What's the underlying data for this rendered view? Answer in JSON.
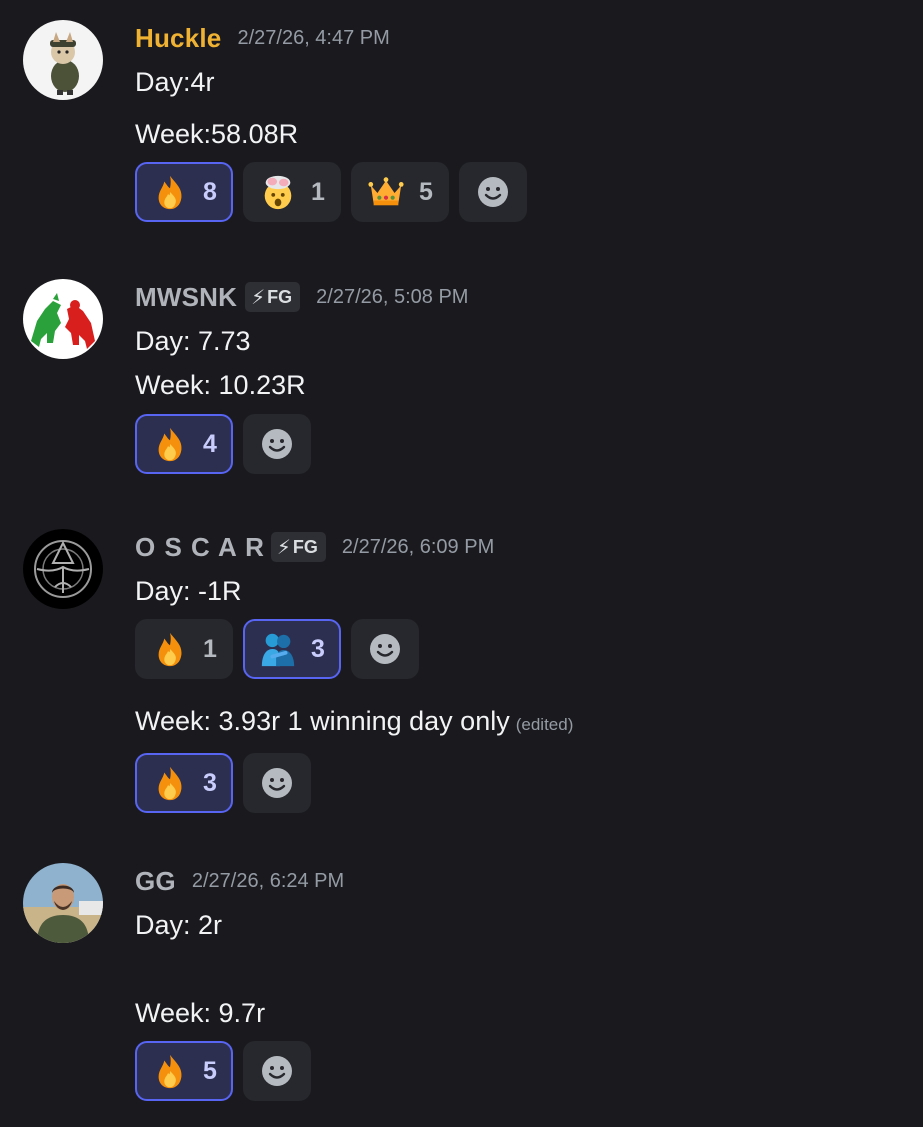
{
  "messages": [
    {
      "username": "Huckle",
      "username_color": "#f0b232",
      "timestamp": "2/27/26, 4:47 PM",
      "lines": [
        "Day:4r",
        "Week:58.08R"
      ],
      "reactions": [
        {
          "emoji": "fire",
          "count": "8",
          "me": true
        },
        {
          "emoji": "exploding-head",
          "count": "1",
          "me": false
        },
        {
          "emoji": "crown",
          "count": "5",
          "me": false
        }
      ]
    },
    {
      "username": "MWSNK",
      "username_color": "#b0b4ba",
      "tag": "FG",
      "timestamp": "2/27/26, 5:08 PM",
      "lines": [
        "Day: 7.73",
        "Week: 10.23R"
      ],
      "reactions": [
        {
          "emoji": "fire",
          "count": "4",
          "me": true
        }
      ]
    },
    {
      "username": "O S C A R",
      "username_color": "#b0b4ba",
      "tag": "FG",
      "timestamp": "2/27/26, 6:09 PM",
      "lines": [
        "Day: -1R"
      ],
      "reactions": [
        {
          "emoji": "fire",
          "count": "1",
          "me": false
        },
        {
          "emoji": "people-hugging",
          "count": "3",
          "me": true
        }
      ],
      "followup": {
        "text": "Week: 3.93r 1 winning day only",
        "edited": "(edited)",
        "reactions": [
          {
            "emoji": "fire",
            "count": "3",
            "me": true
          }
        ]
      }
    },
    {
      "username": "GG",
      "username_color": "#b0b4ba",
      "timestamp": "2/27/26, 6:24 PM",
      "lines": [
        "Day: 2r",
        "",
        "Week: 9.7r"
      ],
      "reactions": [
        {
          "emoji": "fire",
          "count": "5",
          "me": true
        }
      ]
    }
  ],
  "tag_icon": "bolt-icon",
  "add_reaction_icon": "smiley-icon"
}
